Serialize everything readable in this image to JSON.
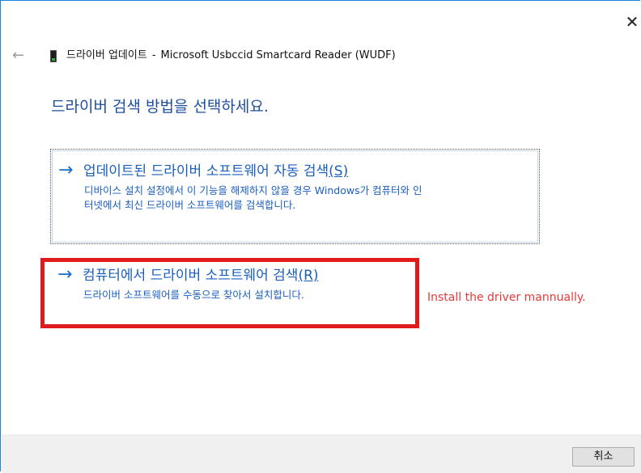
{
  "window": {
    "close_glyph": "✕",
    "back_glyph": "←"
  },
  "header": {
    "title_prefix": "드라이버 업데이트",
    "separator": "-",
    "device_name": "Microsoft Usbccid Smartcard Reader (WUDF)"
  },
  "main": {
    "heading": "드라이버 검색 방법을 선택하세요.",
    "options": [
      {
        "arrow": "→",
        "title": "업데이트된 드라이버 소프트웨어 자동 검색",
        "accelerator": "(S)",
        "description_line1": "디바이스 설치 설정에서 이 기능을 해제하지 않을 경우 Windows가 컴퓨터와 인",
        "description_line2": "터넷에서 최신 드라이버 소프트웨어를 검색합니다."
      },
      {
        "arrow": "→",
        "title": "컴퓨터에서 드라이버 소프트웨어 검색",
        "accelerator": "(R)",
        "description_line1": "드라이버 소프트웨어를 수동으로 찾아서 설치합니다."
      }
    ]
  },
  "annotation": {
    "text": "Install the driver mannually.",
    "color": "#e53a3a"
  },
  "footer": {
    "cancel_label": "취소"
  },
  "colors": {
    "accent": "#1a5fbf",
    "heading": "#1f4e9c",
    "highlight_border": "#e01b1b"
  }
}
